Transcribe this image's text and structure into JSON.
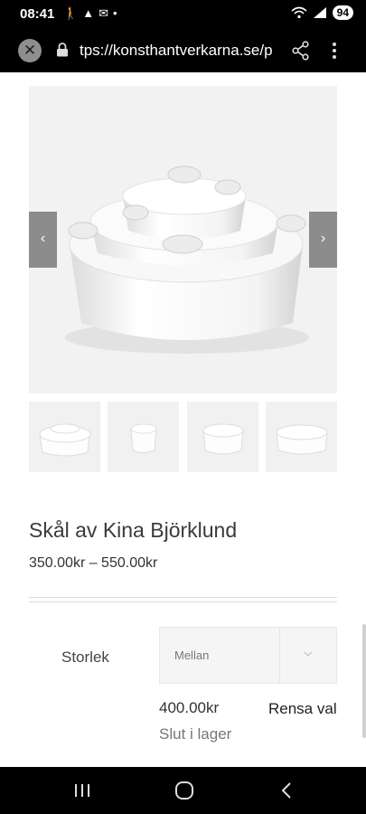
{
  "status_bar": {
    "time": "08:41",
    "left_icons": [
      "walking-icon",
      "warning-icon",
      "mail-icon",
      "dot"
    ],
    "battery": "94"
  },
  "browser": {
    "url": "tps://konsthantverkarna.se/p"
  },
  "gallery": {
    "prev_arrow": "‹",
    "next_arrow": "›",
    "thumbnail_count": 4
  },
  "product": {
    "title": "Skål av Kina Björklund",
    "price_range": "350.00kr – 550.00kr"
  },
  "variation": {
    "label": "Storlek",
    "selected": "Mellan",
    "price": "400.00kr",
    "stock": "Slut i lager",
    "reset_label": "Rensa val"
  },
  "colors": {
    "background": "#ffffff",
    "bars": "#000000",
    "arrow_bg": "#8c8c8c",
    "text": "#333333",
    "muted_text": "#777777"
  }
}
